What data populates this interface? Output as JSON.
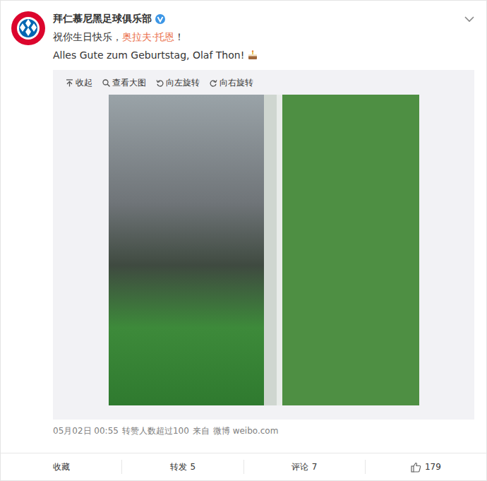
{
  "post": {
    "author": "拜仁慕尼黑足球俱乐部",
    "verified": true,
    "line1": [
      {
        "text": "祝你生日快乐，",
        "link": false
      },
      {
        "text": "奥拉夫·托恩",
        "link": true
      },
      {
        "text": "！",
        "link": false
      }
    ],
    "line2": "Alles Gute zum Geburtstag, Olaf Thon!"
  },
  "media_toolbar": [
    {
      "label": "收起",
      "icon": "collapse"
    },
    {
      "label": "查看大图",
      "icon": "zoom"
    },
    {
      "label": "向左旋转",
      "icon": "rotate-left"
    },
    {
      "label": "向右旋转",
      "icon": "rotate-right"
    }
  ],
  "meta": {
    "date": "05月02日 00:55",
    "note": "转赞人数超过100",
    "source_label": "来自",
    "source": "微博 weibo.com"
  },
  "actions": [
    {
      "kind": "label",
      "label": "收藏"
    },
    {
      "kind": "count",
      "label": "转发",
      "count": "5"
    },
    {
      "kind": "count",
      "label": "评论",
      "count": "7"
    },
    {
      "kind": "like",
      "count": "179"
    }
  ]
}
